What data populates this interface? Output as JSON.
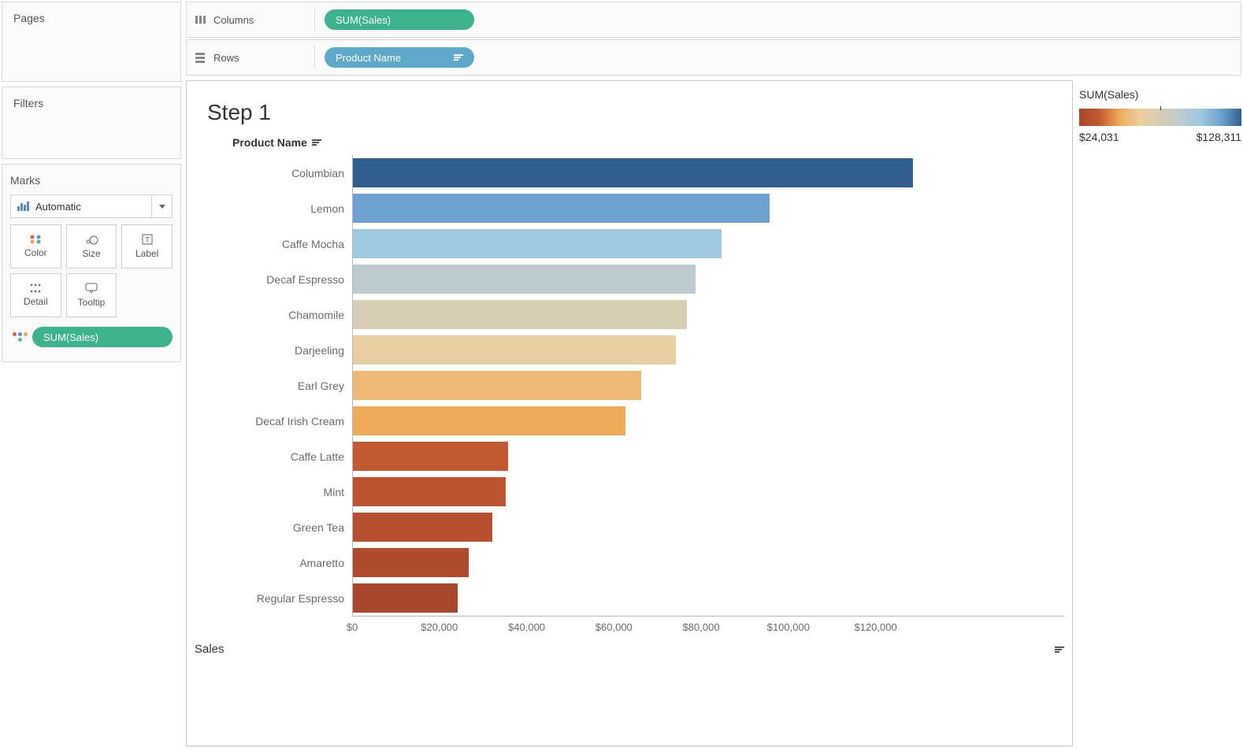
{
  "left": {
    "pages_title": "Pages",
    "filters_title": "Filters",
    "marks_title": "Marks",
    "marks_type": "Automatic",
    "buttons": {
      "color": "Color",
      "size": "Size",
      "label": "Label",
      "detail": "Detail",
      "tooltip": "Tooltip"
    },
    "color_pill": "SUM(Sales)"
  },
  "shelves": {
    "columns_label": "Columns",
    "columns_pill": "SUM(Sales)",
    "rows_label": "Rows",
    "rows_pill": "Product Name"
  },
  "viz": {
    "title": "Step 1",
    "dim_header": "Product Name",
    "x_axis_title": "Sales",
    "x_ticks": [
      "$0",
      "$20,000",
      "$40,000",
      "$60,000",
      "$80,000",
      "$100,000",
      "$120,000"
    ]
  },
  "legend": {
    "title": "SUM(Sales)",
    "min": "$24,031",
    "max": "$128,311"
  },
  "chart_data": {
    "type": "bar",
    "orientation": "horizontal",
    "title": "Step 1",
    "xlabel": "Sales",
    "ylabel": "Product Name",
    "xlim": [
      0,
      130000
    ],
    "color_scale": {
      "field": "SUM(Sales)",
      "min": 24031,
      "max": 128311
    },
    "categories": [
      "Columbian",
      "Lemon",
      "Caffe Mocha",
      "Decaf Espresso",
      "Chamomile",
      "Darjeeling",
      "Earl Grey",
      "Decaf Irish Cream",
      "Caffe Latte",
      "Mint",
      "Green Tea",
      "Amaretto",
      "Regular Espresso"
    ],
    "values": [
      128311,
      95500,
      84500,
      78500,
      76500,
      74000,
      66000,
      62500,
      35500,
      35000,
      32000,
      26500,
      24031
    ],
    "colors": [
      "#2f5f8f",
      "#6ea3cf",
      "#9ec7e0",
      "#bcccce",
      "#d7cdb4",
      "#e8cf9f",
      "#eeb877",
      "#efab5a",
      "#c4582f",
      "#be5330",
      "#b84f2e",
      "#af4b2d",
      "#a8472c"
    ]
  }
}
